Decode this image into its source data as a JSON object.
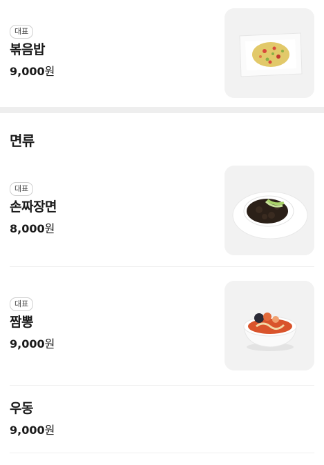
{
  "items_top": [
    {
      "badge": "대표",
      "name": "볶음밥",
      "price": "9,000",
      "currency": "원"
    }
  ],
  "section": {
    "title": "면류",
    "items": [
      {
        "badge": "대표",
        "name": "손짜장면",
        "price": "8,000",
        "currency": "원"
      },
      {
        "badge": "대표",
        "name": "짬뽕",
        "price": "9,000",
        "currency": "원"
      },
      {
        "name": "우동",
        "price": "9,000",
        "currency": "원"
      }
    ]
  },
  "colors": {
    "thumb_bg": "#f2f2f2",
    "divider": "#eeeeee",
    "text": "#1a1a1a"
  },
  "icons": [
    "fried-rice-dish-image",
    "jajangmyeon-dish-image",
    "jjamppong-dish-image"
  ]
}
